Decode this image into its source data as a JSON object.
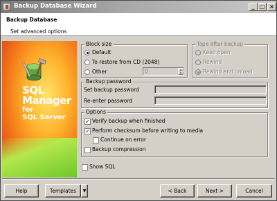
{
  "window": {
    "title": "Backup Database Wizard",
    "controls": {
      "minimize": "_",
      "maximize": "□",
      "close": "×"
    }
  },
  "header": {
    "title": "Backup Database",
    "subtitle": "Set advanced options"
  },
  "banner": {
    "line1": "SQL",
    "line2": "Manager",
    "line3": "for",
    "line4": "SQL Server",
    "logo_icon": "database-tools-icon"
  },
  "block_size": {
    "title": "Block size",
    "options": [
      {
        "label": "Default",
        "checked": true
      },
      {
        "label": "To restore from CD (2048)",
        "checked": false
      },
      {
        "label": "Other",
        "checked": false
      }
    ],
    "other_value": "0"
  },
  "tape": {
    "title": "Tape after backup",
    "options": [
      {
        "label": "Keep open",
        "checked": false
      },
      {
        "label": "Rewind",
        "checked": false
      },
      {
        "label": "Rewind and unload",
        "checked": true
      }
    ]
  },
  "password": {
    "title": "Backup password",
    "set_label": "Set backup password",
    "reenter_label": "Re-enter password",
    "set_value": "",
    "reenter_value": ""
  },
  "options": {
    "title": "Options",
    "items": [
      {
        "label": "Verify backup when finished",
        "checked": true
      },
      {
        "label": "Perform checksum before writing to media",
        "checked": true
      },
      {
        "label": "Continue on error",
        "checked": false
      },
      {
        "label": "Backup compression",
        "checked": false
      }
    ]
  },
  "show_sql": {
    "label": "Show SQL",
    "checked": false
  },
  "buttons": {
    "help": "Help",
    "templates": "Templates",
    "back": "< Back",
    "next": "Next >",
    "cancel": "Cancel"
  },
  "colors": {
    "titlebar": "#7b7b7b",
    "dialog_bg": "#d4d0c8",
    "banner_orange": "#f2731a",
    "banner_green": "#69c52a"
  }
}
